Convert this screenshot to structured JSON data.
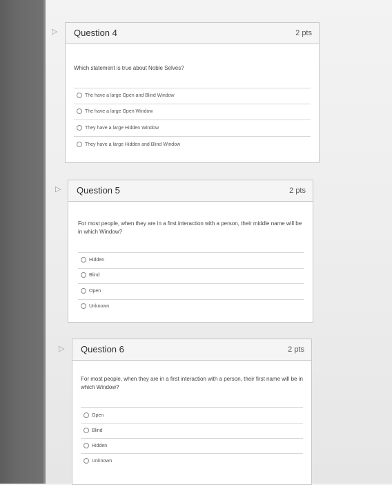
{
  "questions": [
    {
      "title": "Question 4",
      "points": "2 pts",
      "text": "Which statement is true about Noble Selves?",
      "options": [
        "The have a large Open and Blind Window",
        "The have a large Open Window",
        "They have a large Hidden Window",
        "They have a large Hidden and Blind Window"
      ]
    },
    {
      "title": "Question 5",
      "points": "2 pts",
      "text": "For most people, when they are in a first interaction with a person, their middle name will be in which Window?",
      "options": [
        "Hidden",
        "Blind",
        "Open",
        "Unknown"
      ]
    },
    {
      "title": "Question 6",
      "points": "2 pts",
      "text": "For most people, when they are in a first interaction with a person, their first name will be in which Window?",
      "options": [
        "Open",
        "Blind",
        "Hidden",
        "Unknown"
      ]
    }
  ],
  "icons": {
    "flag": "flag-icon",
    "radio": "radio-icon"
  }
}
